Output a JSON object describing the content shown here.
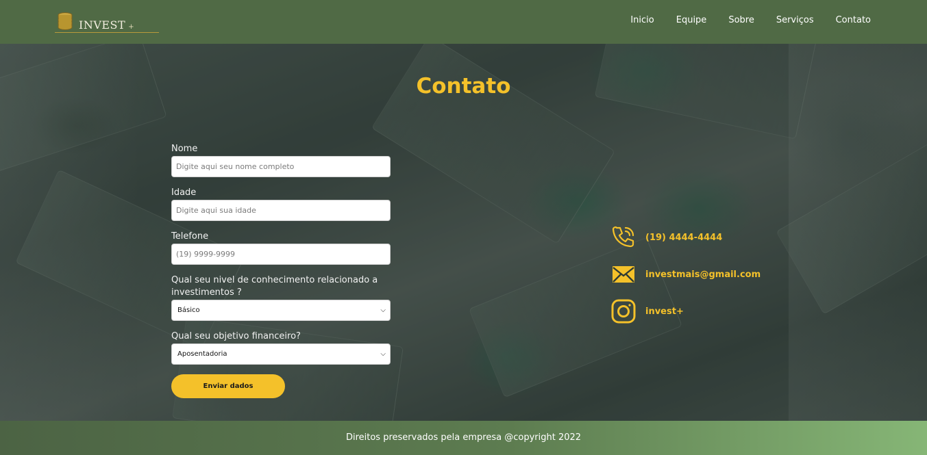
{
  "brand": {
    "name": "INVEST",
    "suffix": "+"
  },
  "nav": [
    {
      "label": "Inicio"
    },
    {
      "label": "Equipe"
    },
    {
      "label": "Sobre"
    },
    {
      "label": "Serviços"
    },
    {
      "label": "Contato"
    }
  ],
  "page": {
    "title": "Contato"
  },
  "form": {
    "nome": {
      "label": "Nome",
      "placeholder": "Digite aqui seu nome completo"
    },
    "idade": {
      "label": "Idade",
      "placeholder": "Digite aqui sua idade"
    },
    "telefone": {
      "label": "Telefone",
      "placeholder": "(19) 9999-9999"
    },
    "conhecimento": {
      "label": "Qual seu nivel de conhecimento relacionado a investimentos ?",
      "selected": "Básico"
    },
    "objetivo": {
      "label": "Qual seu objetivo financeiro?",
      "selected": "Aposentadoria"
    },
    "submit_label": "Enviar dados"
  },
  "contact": {
    "phone": "(19) 4444-4444",
    "email": "investmais@gmail.com",
    "instagram": "invest+"
  },
  "icons": {
    "logo": "coin-stack-icon",
    "phone": "phone-icon",
    "email": "envelope-icon",
    "instagram": "instagram-icon",
    "select": "chevron-down-icon"
  },
  "colors": {
    "accent": "#f4c12a",
    "header": "#506a45",
    "footer_start": "#4c6344",
    "footer_end": "#86b676"
  },
  "footer": {
    "text": "Direitos preservados pela empresa @copyright 2022"
  }
}
